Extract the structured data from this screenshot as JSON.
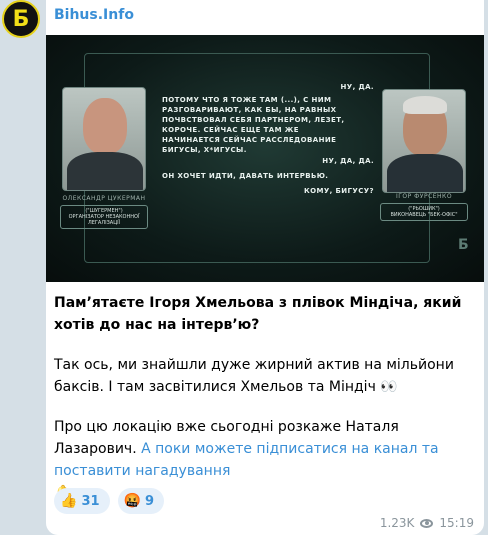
{
  "channel": {
    "name": "Bihus.Info",
    "avatar_glyph": "Б",
    "accent_color": "#3a8fd6",
    "avatar_colors": [
      "#111111",
      "#f2df18"
    ]
  },
  "media": {
    "transcript_left": "ПОТОМУ ЧТО Я ТОЖЕ ТАМ (...), С НИМ РАЗГОВАРИВАЮТ, КАК БЫ, НА РАВНЫХ ПОЧВСТВОВАЛ СЕБЯ ПАРТНЕРОМ, ЛЕЗЕТ, КОРОЧЕ. СЕЙЧАС ЕЩЕ ТАМ ЖЕ НАЧИНАЕТСЯ СЕЙЧАС РАССЛЕДОВАНИЕ БИГУСЫ, Х*ИГУСЫ.",
    "transcript_left_2": "ОН ХОЧЕТ ИДТИ, ДАВАТЬ ИНТЕРВЬЮ.",
    "reply_1": "НУ, ДА.",
    "reply_2": "НУ, ДА, ДА.",
    "reply_3": "КОМУ, БИГУСУ?",
    "left_person": {
      "name": "ОЛЕКСАНДР ЦУКЕРМАН",
      "tag": "(\"ШУГЕРМЕН\")\nОРГАНІЗАТОР НЕЗАКОННОЇ ЛЕГАЛІЗАЦІЇ"
    },
    "right_person": {
      "name": "ІГОР ФУРСЕНКО",
      "tag": "(\"РЬОШИК\")\nВИКОНАВЕЦЬ \"БЕК-ОФІС\""
    },
    "watermark": "Б"
  },
  "post": {
    "headline": "Пам’ятаєте Ігоря Хмельова з плівок Міндіча, який хотів до нас на інтерв’ю?",
    "paragraph_1": "Так ось, ми знайшли дуже жирний актив на мільйони баксів. І там засвітилися Хмельов та Міндіч 👀",
    "paragraph_2_text": "Про цю локацію вже сьогодні розкаже Наталя Лазарович. ",
    "paragraph_2_link": "А поки можете підписатися на канал та поставити нагадування",
    "paragraph_2_emoji": "🔔"
  },
  "reactions": [
    {
      "emoji": "👍",
      "count": "31"
    },
    {
      "emoji": "🤬",
      "count": "9"
    }
  ],
  "meta": {
    "views": "1.23K",
    "time": "15:19"
  }
}
